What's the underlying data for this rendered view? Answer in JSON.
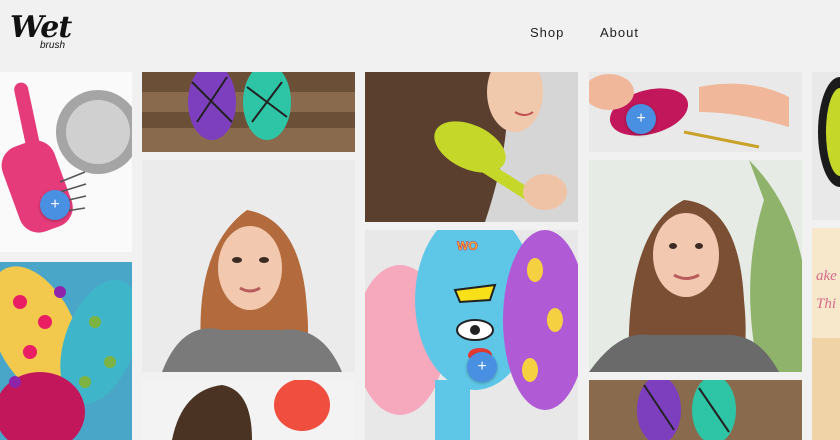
{
  "brand": {
    "logo_main": "Wet",
    "logo_sub": "brush"
  },
  "nav": {
    "items": [
      {
        "label": "Shop"
      },
      {
        "label": "About"
      }
    ]
  },
  "grid": {
    "plus_symbol": "+"
  },
  "colors": {
    "accent": "#4a90e2",
    "background": "#f1f1f1"
  }
}
